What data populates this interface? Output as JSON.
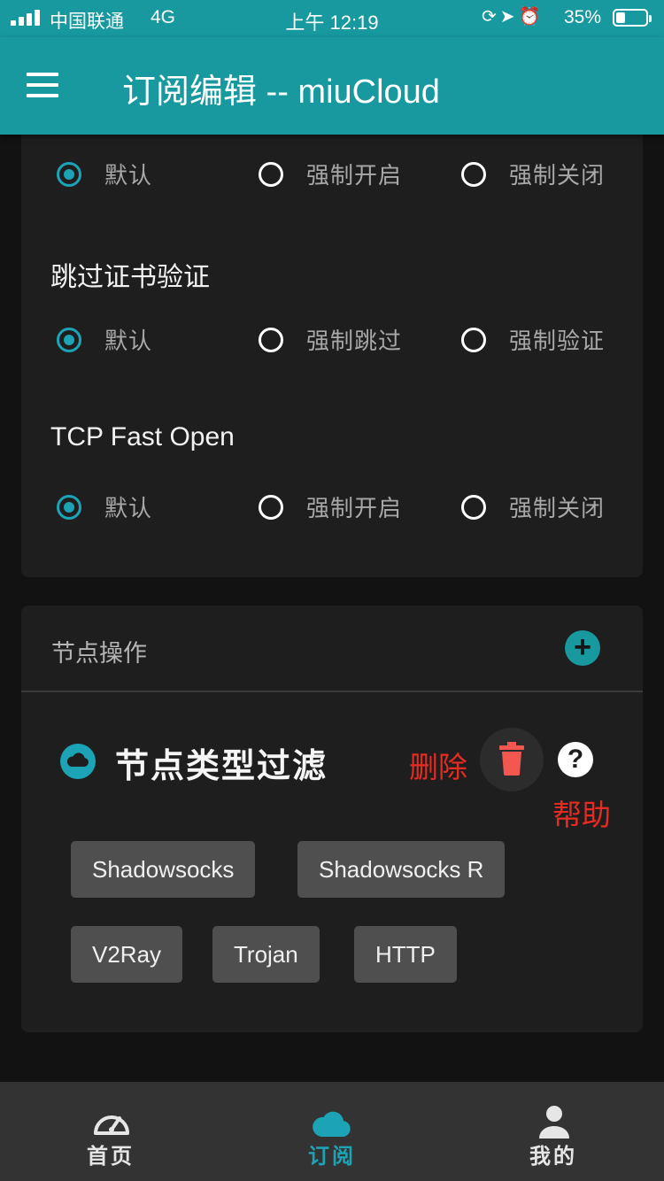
{
  "status_bar": {
    "carrier": "中国联通",
    "network": "4G",
    "time": "上午 12:19",
    "battery_percent": "35%",
    "battery_level": 0.35,
    "icons": [
      "orientation-lock-icon",
      "location-icon",
      "alarm-icon"
    ]
  },
  "app_bar": {
    "title": "订阅编辑 -- miuCloud"
  },
  "settings_card": {
    "groups": [
      {
        "label": "",
        "options": [
          "默认",
          "强制开启",
          "强制关闭"
        ],
        "selected": 0
      },
      {
        "label": "跳过证书验证",
        "options": [
          "默认",
          "强制跳过",
          "强制验证"
        ],
        "selected": 0
      },
      {
        "label": "TCP Fast Open",
        "options": [
          "默认",
          "强制开启",
          "强制关闭"
        ],
        "selected": 0
      }
    ]
  },
  "node_ops": {
    "header": "节点操作",
    "add_icon": "plus-icon",
    "filter": {
      "title": "节点类型过滤",
      "delete_label": "删除",
      "help_label": "帮助",
      "help_icon_text": "?",
      "chips": [
        "Shadowsocks",
        "Shadowsocks R",
        "V2Ray",
        "Trojan",
        "HTTP"
      ]
    }
  },
  "bottom_nav": {
    "items": [
      {
        "label": "首页",
        "icon": "speedometer-icon"
      },
      {
        "label": "订阅",
        "icon": "cloud-icon"
      },
      {
        "label": "我的",
        "icon": "person-icon"
      }
    ],
    "active": 1
  },
  "colors": {
    "accent": "#17999f",
    "radio_accent": "#1ca3b5",
    "annotation_red": "#e52b22",
    "card_bg": "#1e1e1e",
    "page_bg": "#121212"
  }
}
